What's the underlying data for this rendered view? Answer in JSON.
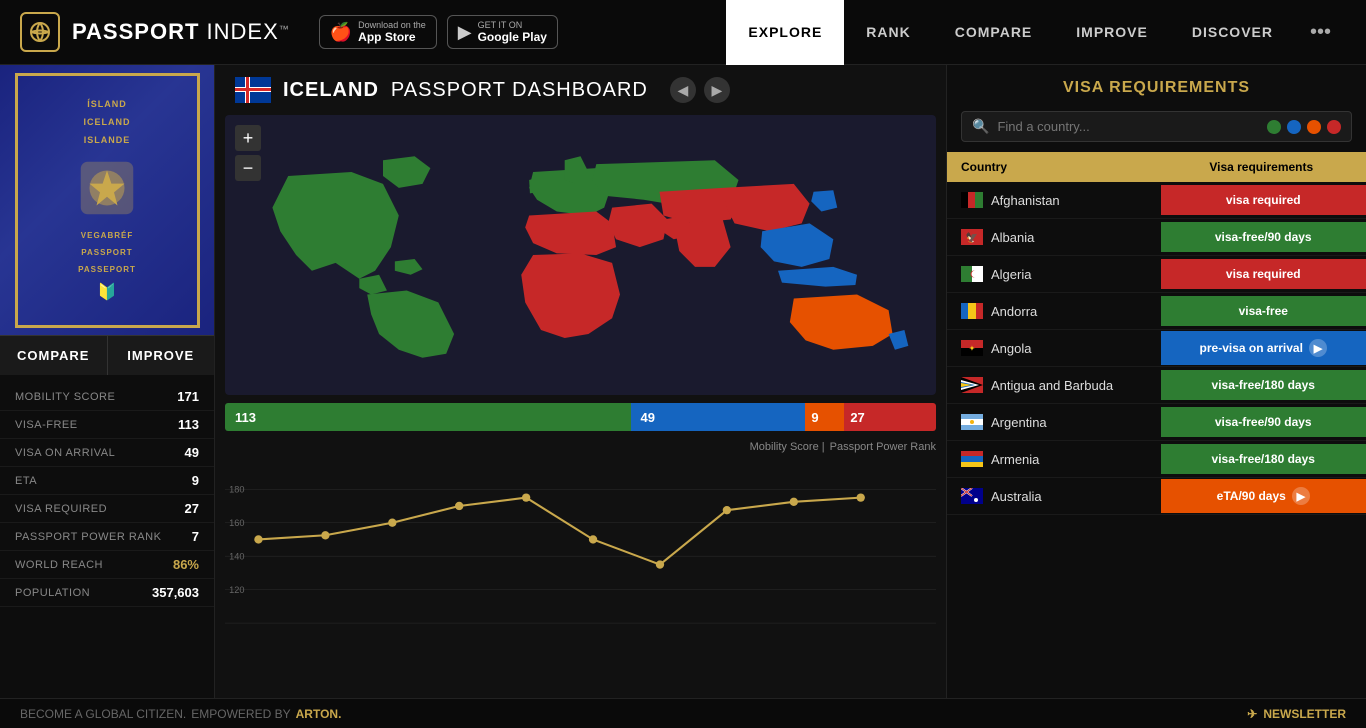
{
  "header": {
    "logo_text": "PASSPORT",
    "logo_text2": " INDEX",
    "logo_tm": "™",
    "appstore_label": "Download on the",
    "appstore_name": "App Store",
    "playstore_label": "GET IT ON",
    "playstore_name": "Google Play",
    "nav": [
      {
        "id": "explore",
        "label": "EXPLORE",
        "active": true
      },
      {
        "id": "rank",
        "label": "RANK",
        "active": false
      },
      {
        "id": "compare",
        "label": "COMPARE",
        "active": false
      },
      {
        "id": "improve",
        "label": "IMPROVE",
        "active": false
      },
      {
        "id": "discover",
        "label": "DISCOVER",
        "active": false
      }
    ],
    "more_dots": "•••"
  },
  "dashboard": {
    "country": "ICELAND",
    "title_suffix": " PASSPORT DASHBOARD"
  },
  "passport": {
    "line1": "ÍSLAND",
    "line2": "ICELAND",
    "line3": "ISLANDE",
    "subtitle1": "VEGABRÉF",
    "subtitle2": "PASSPORT",
    "subtitle3": "PASSEPORT"
  },
  "buttons": {
    "compare": "COMPARE",
    "improve": "IMPROVE"
  },
  "stats": [
    {
      "label": "MOBILITY SCORE",
      "value": "171",
      "gold": false
    },
    {
      "label": "VISA-FREE",
      "value": "113",
      "gold": false
    },
    {
      "label": "VISA ON ARRIVAL",
      "value": "49",
      "gold": false
    },
    {
      "label": "ETA",
      "value": "9",
      "gold": false
    },
    {
      "label": "VISA REQUIRED",
      "value": "27",
      "gold": false
    },
    {
      "label": "PASSPORT POWER RANK",
      "value": "7",
      "gold": false
    },
    {
      "label": "WORLD REACH",
      "value": "86%",
      "gold": true
    },
    {
      "label": "POPULATION",
      "value": "357,603",
      "gold": false
    }
  ],
  "score_bar": [
    {
      "value": "113",
      "type": "green",
      "flex": 6
    },
    {
      "value": "49",
      "type": "blue",
      "flex": 2.5
    },
    {
      "value": "9",
      "type": "orange",
      "flex": 0.5
    },
    {
      "value": "27",
      "type": "red",
      "flex": 1.3
    }
  ],
  "score_labels": {
    "mobility": "Mobility Score |",
    "rank": "Passport Power Rank"
  },
  "visa_requirements": {
    "title": "VISA REQUIREMENTS",
    "search_placeholder": "Find a country...",
    "col_country": "Country",
    "col_visa": "Visa requirements"
  },
  "countries": [
    {
      "name": "Afghanistan",
      "flag_color": "#000",
      "flag_code": "af",
      "visa_type": "visa-required",
      "visa_label": "visa required"
    },
    {
      "name": "Albania",
      "flag_color": "#c62828",
      "flag_code": "al",
      "visa_type": "visa-free-90",
      "visa_label": "visa-free/90 days"
    },
    {
      "name": "Algeria",
      "flag_color": "#2e7d32",
      "flag_code": "dz",
      "visa_type": "visa-required",
      "visa_label": "visa required"
    },
    {
      "name": "Andorra",
      "flag_color": "#1565c0",
      "flag_code": "ad",
      "visa_type": "visa-free",
      "visa_label": "visa-free"
    },
    {
      "name": "Angola",
      "flag_color": "#c62828",
      "flag_code": "ao",
      "visa_type": "pre-visa",
      "visa_label": "pre-visa on arrival",
      "info": true
    },
    {
      "name": "Antigua and Barbuda",
      "flag_color": "#c62828",
      "flag_code": "ag",
      "visa_type": "visa-free-180",
      "visa_label": "visa-free/180 days"
    },
    {
      "name": "Argentina",
      "flag_color": "#87ceeb",
      "flag_code": "ar",
      "visa_type": "visa-free-90",
      "visa_label": "visa-free/90 days"
    },
    {
      "name": "Armenia",
      "flag_color": "#c62828",
      "flag_code": "am",
      "visa_type": "visa-free-180",
      "visa_label": "visa-free/180 days"
    },
    {
      "name": "Australia",
      "flag_color": "#1565c0",
      "flag_code": "au",
      "visa_type": "eta",
      "visa_label": "eTA/90 days",
      "info": true
    }
  ],
  "footer": {
    "become": "BECOME A GLOBAL CITIZEN.",
    "powered": "EMPOWERED BY",
    "brand": "ARTON.",
    "newsletter": "NEWSLETTER"
  },
  "map_controls": {
    "zoom_in": "+",
    "zoom_out": "−"
  }
}
